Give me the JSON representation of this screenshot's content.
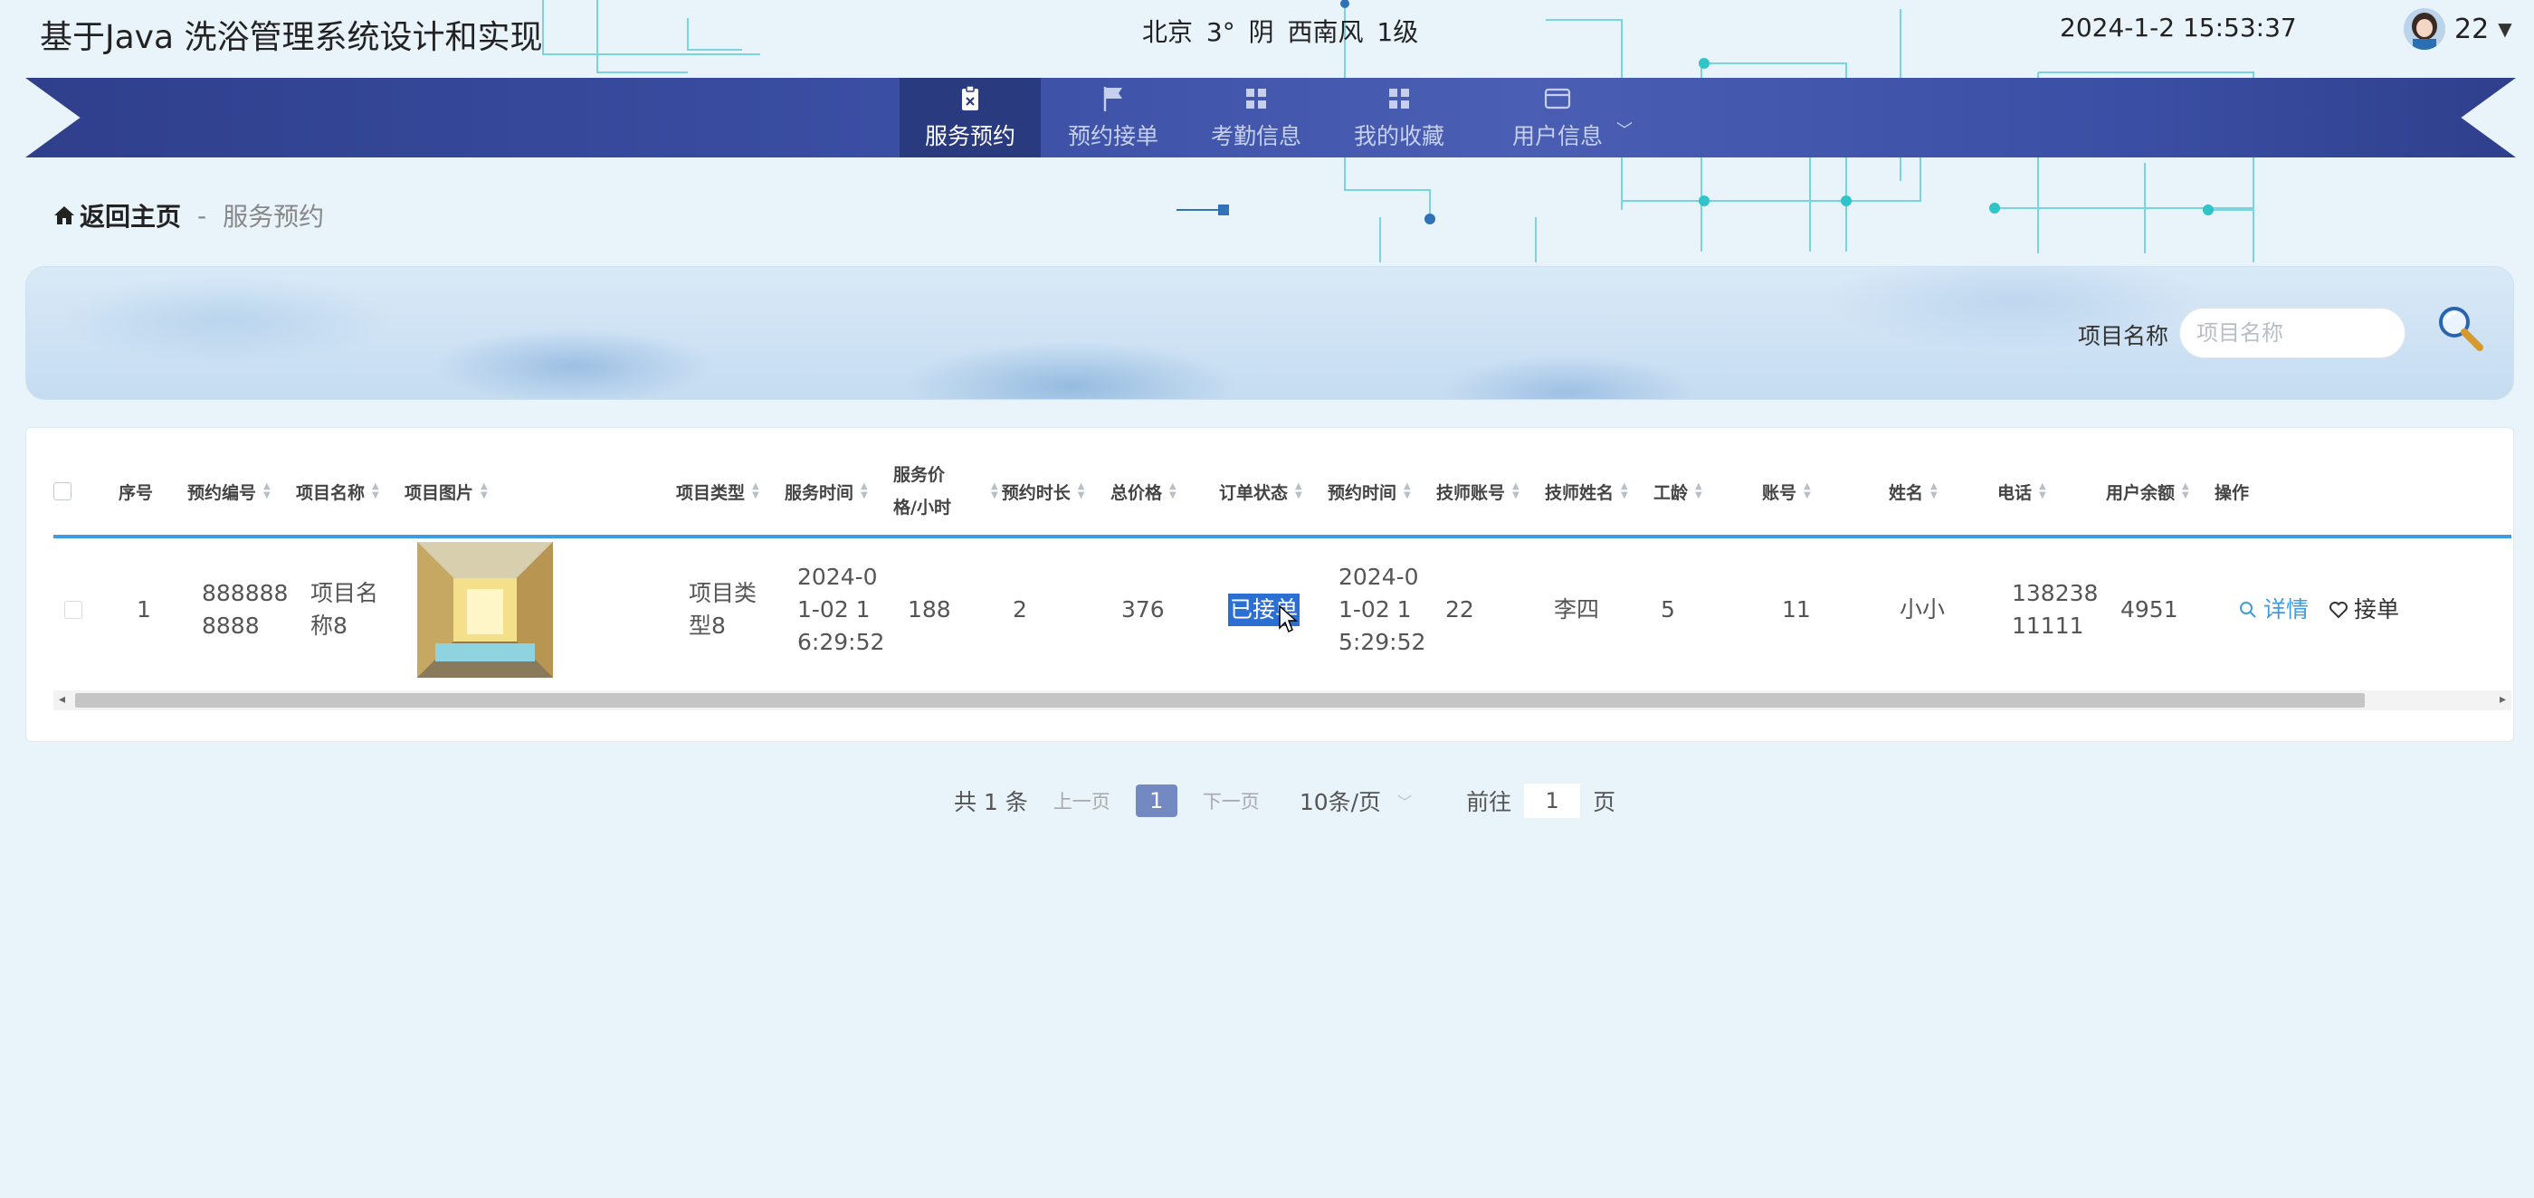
{
  "header": {
    "site_title": "基于Java 洗浴管理系统设计和实现",
    "weather": "北京  3°  阴  西南风  1级",
    "datetime": "2024-1-2 15:53:37",
    "user_name": "22"
  },
  "nav": {
    "items": [
      {
        "label": "服务预约",
        "icon": "clipboard-icon",
        "active": true
      },
      {
        "label": "预约接单",
        "icon": "flag-icon",
        "active": false
      },
      {
        "label": "考勤信息",
        "icon": "grid-icon",
        "active": false
      },
      {
        "label": "我的收藏",
        "icon": "grid-icon",
        "active": false
      },
      {
        "label": "用户信息",
        "icon": "card-icon",
        "active": false
      }
    ]
  },
  "breadcrumb": {
    "home": "返回主页",
    "separator": "-",
    "current": "服务预约"
  },
  "search": {
    "label": "项目名称",
    "placeholder": "项目名称"
  },
  "table": {
    "columns": [
      "序号",
      "预约编号",
      "项目名称",
      "项目图片",
      "项目类型",
      "服务时间",
      "服务价格/小时",
      "预约时长",
      "总价格",
      "订单状态",
      "预约时间",
      "技师账号",
      "技师姓名",
      "工龄",
      "账号",
      "姓名",
      "电话",
      "用户余额",
      "操作"
    ],
    "rows": [
      {
        "index": "1",
        "order_no": "888888 8888",
        "project_name": "项目名 称8",
        "project_type": "项目类 型8",
        "service_time": "2024-0 1-02 1 6:29:52",
        "price_per_hour": "188",
        "duration": "2",
        "total_price": "376",
        "status": "已接单",
        "booking_time": "2024-0 1-02 1 5:29:52",
        "tech_account": "22",
        "tech_name": "李四",
        "years": "5",
        "account": "11",
        "name": "小小",
        "phone": "138238 11111",
        "balance": "4951",
        "action_detail": "详情",
        "action_take": "接单"
      }
    ]
  },
  "pagination": {
    "total": "共 1 条",
    "prev": "上一页",
    "current": "1",
    "next": "下一页",
    "page_size": "10条/页",
    "goto_label": "前往",
    "goto_value": "1",
    "goto_suffix": "页"
  },
  "colors": {
    "nav_bg": "#3a4ea3",
    "nav_active": "#2a3a7e",
    "accent": "#3d9ce2",
    "page_bg": "#e9f3fa",
    "pager_active": "#7289c2"
  }
}
